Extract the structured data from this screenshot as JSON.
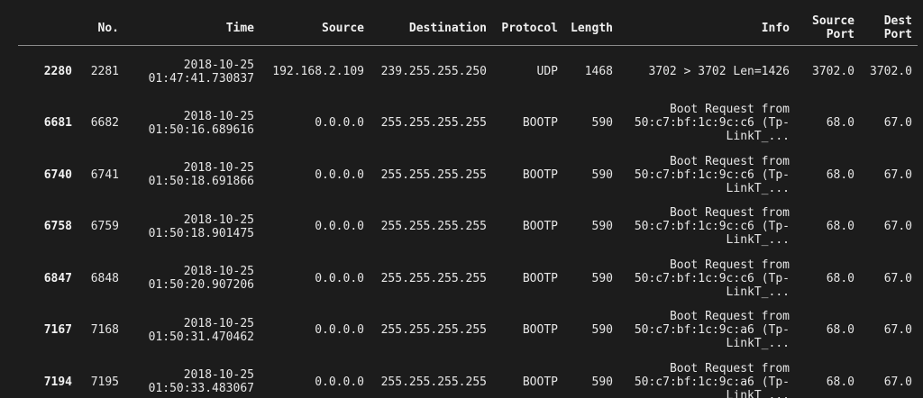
{
  "table": {
    "columns": {
      "index": "",
      "no": "No.",
      "time": "Time",
      "source": "Source",
      "destination": "Destination",
      "protocol": "Protocol",
      "length": "Length",
      "info": "Info",
      "source_port_line1": "Source",
      "source_port_line2": "Port",
      "dest_port_line1": "Dest",
      "dest_port_line2": "Port"
    },
    "rows": [
      {
        "index": "2280",
        "no": "2281",
        "date": "2018-10-25",
        "clock": "01:47:41.730837",
        "source": "192.168.2.109",
        "destination": "239.255.255.250",
        "protocol": "UDP",
        "length": "1468",
        "info": "3702 > 3702 Len=1426",
        "source_port": "3702.0",
        "dest_port": "3702.0"
      },
      {
        "index": "6681",
        "no": "6682",
        "date": "2018-10-25",
        "clock": "01:50:16.689616",
        "source": "0.0.0.0",
        "destination": "255.255.255.255",
        "protocol": "BOOTP",
        "length": "590",
        "info_l1": "Boot Request from",
        "info_l2": "50:c7:bf:1c:9c:c6 (Tp-",
        "info_l3": "LinkT_...",
        "source_port": "68.0",
        "dest_port": "67.0"
      },
      {
        "index": "6740",
        "no": "6741",
        "date": "2018-10-25",
        "clock": "01:50:18.691866",
        "source": "0.0.0.0",
        "destination": "255.255.255.255",
        "protocol": "BOOTP",
        "length": "590",
        "info_l1": "Boot Request from",
        "info_l2": "50:c7:bf:1c:9c:c6 (Tp-",
        "info_l3": "LinkT_...",
        "source_port": "68.0",
        "dest_port": "67.0"
      },
      {
        "index": "6758",
        "no": "6759",
        "date": "2018-10-25",
        "clock": "01:50:18.901475",
        "source": "0.0.0.0",
        "destination": "255.255.255.255",
        "protocol": "BOOTP",
        "length": "590",
        "info_l1": "Boot Request from",
        "info_l2": "50:c7:bf:1c:9c:c6 (Tp-",
        "info_l3": "LinkT_...",
        "source_port": "68.0",
        "dest_port": "67.0"
      },
      {
        "index": "6847",
        "no": "6848",
        "date": "2018-10-25",
        "clock": "01:50:20.907206",
        "source": "0.0.0.0",
        "destination": "255.255.255.255",
        "protocol": "BOOTP",
        "length": "590",
        "info_l1": "Boot Request from",
        "info_l2": "50:c7:bf:1c:9c:c6 (Tp-",
        "info_l3": "LinkT_...",
        "source_port": "68.0",
        "dest_port": "67.0"
      },
      {
        "index": "7167",
        "no": "7168",
        "date": "2018-10-25",
        "clock": "01:50:31.470462",
        "source": "0.0.0.0",
        "destination": "255.255.255.255",
        "protocol": "BOOTP",
        "length": "590",
        "info_l1": "Boot Request from",
        "info_l2": "50:c7:bf:1c:9c:a6 (Tp-",
        "info_l3": "LinkT_...",
        "source_port": "68.0",
        "dest_port": "67.0"
      },
      {
        "index": "7194",
        "no": "7195",
        "date": "2018-10-25",
        "clock": "01:50:33.483067",
        "source": "0.0.0.0",
        "destination": "255.255.255.255",
        "protocol": "BOOTP",
        "length": "590",
        "info_l1": "Boot Request from",
        "info_l2": "50:c7:bf:1c:9c:a6 (Tp-",
        "info_l3": "LinkT_...",
        "source_port": "68.0",
        "dest_port": "67.0"
      }
    ]
  },
  "colors": {
    "background": "#1c1c1c",
    "text": "#e6e6e6",
    "header_rule": "#8a8a8a"
  }
}
